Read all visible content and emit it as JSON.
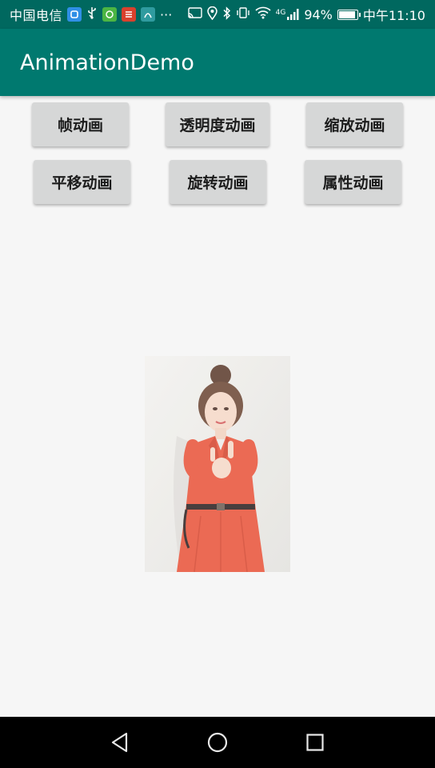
{
  "status_bar": {
    "carrier": "中国电信",
    "overflow": "···",
    "network_label": "4G",
    "battery": "94%",
    "battery_level": 0.94,
    "time": "中午11:10",
    "icons": [
      "app-icon-1",
      "usb-icon",
      "app-icon-2",
      "app-icon-3",
      "app-icon-4",
      "cast-icon",
      "location-icon",
      "bluetooth-icon",
      "vibrate-icon",
      "wifi-icon",
      "signal-icon",
      "battery-icon"
    ]
  },
  "app_bar": {
    "title": "AnimationDemo"
  },
  "buttons": {
    "row1": [
      {
        "label": "帧动画"
      },
      {
        "label": "透明度动画"
      },
      {
        "label": "缩放动画"
      }
    ],
    "row2": [
      {
        "label": "平移动画"
      },
      {
        "label": "旋转动画"
      },
      {
        "label": "属性动画"
      }
    ]
  },
  "image": {
    "subject": "woman-in-red-coat-thumbs-up"
  },
  "nav_bar": {
    "icons": [
      "back-icon",
      "home-icon",
      "recents-icon"
    ]
  },
  "colors": {
    "status_bar": "#00685f",
    "app_bar": "#00796f",
    "background": "#f6f6f6",
    "button": "#d6d7d7",
    "coat": "#ea5238",
    "nav_bar": "#000000"
  }
}
